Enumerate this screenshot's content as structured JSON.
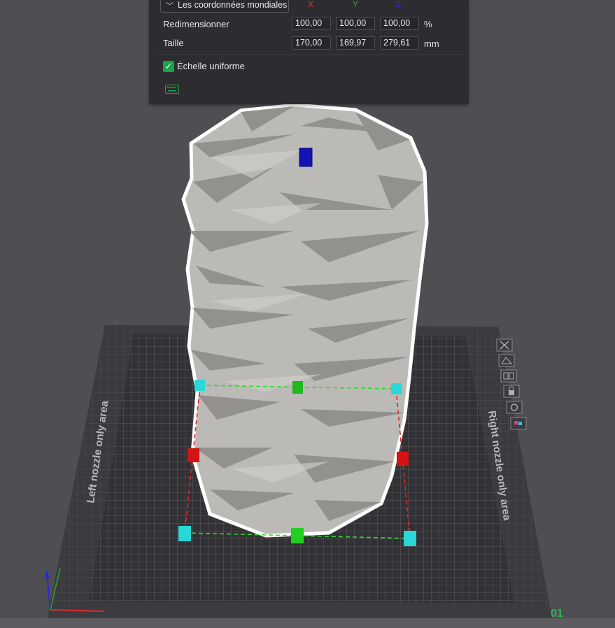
{
  "panel": {
    "coord_dropdown": "Les coordonnées mondiales",
    "axes": {
      "x": "X",
      "y": "Y",
      "z": "Z"
    },
    "scale_row": {
      "label": "Redimensionner",
      "x": "100,00",
      "y": "100,00",
      "z": "100,00",
      "unit": "%"
    },
    "size_row": {
      "label": "Taille",
      "x": "170,00",
      "y": "169,97",
      "z": "279,61",
      "unit": "mm"
    },
    "uniform_scale": {
      "label": "Échelle uniforme",
      "checked": true
    }
  },
  "bed": {
    "left_area_label": "Left nozzle only area",
    "right_area_label": "Right nozzle only area",
    "plate_number": "01"
  },
  "colors": {
    "axis_x": "#e03030",
    "axis_y": "#2fa82f",
    "axis_z": "#3030d0",
    "accent": "#1aa34a",
    "panel_bg": "#2d2d31",
    "viewport_bg": "#4e4e53"
  },
  "icons": {
    "side_toolbar": [
      "close-icon",
      "orient-icon",
      "arrange-icon",
      "lock-icon",
      "settings-icon",
      "color-icon"
    ],
    "panel": [
      "chevron-down-icon",
      "checkmark-icon",
      "keyboard-icon"
    ]
  }
}
